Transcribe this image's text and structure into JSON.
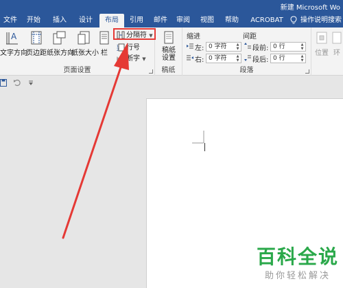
{
  "window": {
    "title": "新建 Microsoft Wo"
  },
  "tabs": [
    {
      "label": "文件",
      "active": false
    },
    {
      "label": "开始",
      "active": false
    },
    {
      "label": "插入",
      "active": false
    },
    {
      "label": "设计",
      "active": false
    },
    {
      "label": "布局",
      "active": true
    },
    {
      "label": "引用",
      "active": false
    },
    {
      "label": "邮件",
      "active": false
    },
    {
      "label": "审阅",
      "active": false
    },
    {
      "label": "视图",
      "active": false
    },
    {
      "label": "帮助",
      "active": false
    },
    {
      "label": "ACROBAT",
      "active": false
    }
  ],
  "tell_me": "操作说明搜索",
  "page_setup": {
    "label": "页面设置",
    "text_direction": "文字方向",
    "margins": "页边距",
    "orientation": "纸张方向",
    "size": "纸张大小",
    "columns": "栏",
    "breaks": "分隔符",
    "line_numbers": "行号",
    "hyphenation": "断字"
  },
  "draft": {
    "label": "稿纸",
    "button": "稿纸\n设置"
  },
  "paragraph": {
    "label": "段落",
    "indent_header": "缩进",
    "spacing_header": "间距",
    "left_label": "左:",
    "right_label": "右:",
    "left_value": "0 字符",
    "right_value": "0 字符",
    "before_label": "段前:",
    "after_label": "段后:",
    "before_value": "0 行",
    "after_value": "0 行"
  },
  "arrange": {
    "position": "位置",
    "wrap": "环"
  },
  "watermark": {
    "title": "百科全说",
    "subtitle": "助你轻松解决"
  },
  "colors": {
    "accent": "#2b579a",
    "highlight": "#e53935",
    "watermark": "#2aa84a"
  }
}
